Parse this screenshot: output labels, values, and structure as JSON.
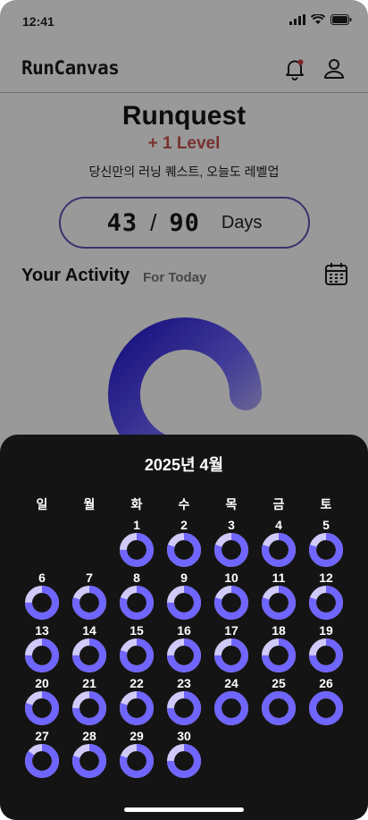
{
  "status": {
    "time": "12:41"
  },
  "app": {
    "logo": "RunCanvas"
  },
  "hero": {
    "title": "Runquest",
    "level": "+ 1 Level",
    "subtitle": "당신만의 러닝 퀘스트, 오늘도 레벨업"
  },
  "progress": {
    "done": "43",
    "total": "90",
    "separator": "/",
    "unit": "Days"
  },
  "activity": {
    "title": "Your Activity",
    "subtitle": "For Today"
  },
  "calendar": {
    "title": "2025년 4월",
    "weekdays": [
      "일",
      "월",
      "화",
      "수",
      "목",
      "금",
      "토"
    ],
    "first_weekday_index": 2,
    "days": [
      "1",
      "2",
      "3",
      "4",
      "5",
      "6",
      "7",
      "8",
      "9",
      "10",
      "11",
      "12",
      "13",
      "14",
      "15",
      "16",
      "17",
      "18",
      "19",
      "20",
      "21",
      "22",
      "23",
      "24",
      "25",
      "26",
      "27",
      "28",
      "29",
      "30"
    ],
    "ring_progress": [
      0.75,
      0.8,
      0.8,
      0.8,
      0.8,
      0.75,
      0.8,
      0.8,
      0.75,
      0.8,
      0.8,
      0.8,
      0.75,
      0.75,
      0.8,
      0.75,
      0.75,
      0.75,
      0.75,
      0.8,
      0.75,
      0.8,
      0.75,
      1.0,
      1.0,
      1.0,
      0.85,
      0.8,
      0.8,
      0.75
    ]
  },
  "colors": {
    "accent": "#6f65ff",
    "ring_light": "#cfcaf7",
    "level_red": "#c7524f",
    "sheet_bg": "#151414"
  }
}
